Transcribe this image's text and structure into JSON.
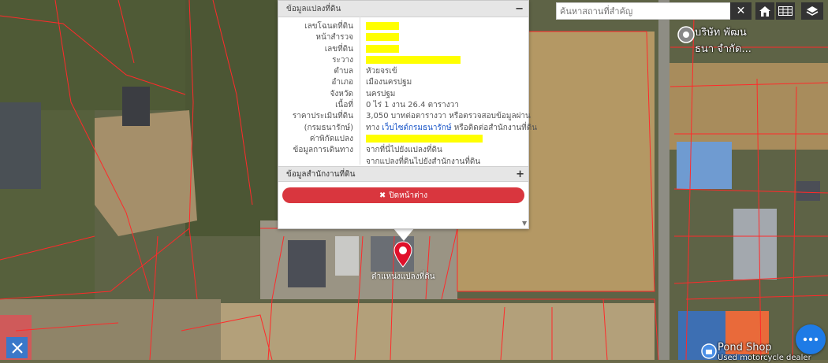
{
  "popup": {
    "section1_title": "ข้อมูลแปลงที่ดิน",
    "section1_toggle": "−",
    "rows": [
      {
        "label": "เลขโฉนดที่ดิน",
        "value": "",
        "redacted": true
      },
      {
        "label": "หน้าสำรวจ",
        "value": "",
        "redacted": true
      },
      {
        "label": "เลขที่ดิน",
        "value": "",
        "redacted": true
      },
      {
        "label": "ระวาง",
        "value": "",
        "redacted": true
      },
      {
        "label": "ตำบล",
        "value": "หัวยจรเข้",
        "redacted": false
      },
      {
        "label": "อำเภอ",
        "value": "เมืองนครปฐม",
        "redacted": false
      },
      {
        "label": "จังหวัด",
        "value": "นครปฐม",
        "redacted": false
      },
      {
        "label": "เนื้อที่",
        "value": "0 ไร่ 1 งาน 26.4 ตารางวา",
        "redacted": false
      }
    ],
    "price_label": "ราคาประเมินที่ดิน",
    "price_value": "3,050 บาทต่อตารางวา หรือตรวจสอบข้อมูลผ่าน",
    "price_label2": "(กรมธนารักษ์)",
    "price_value2_pre": "ทาง",
    "price_link": "เว็บไซต์กรมธนารักษ์",
    "price_value2_post": "หรือติดต่อสำนักงานที่ดิน",
    "coord_label": "ค่าพิกัดแปลง",
    "travel_label": "ข้อมูลการเดินทาง",
    "travel_link1": "จากที่นี่ไปยังแปลงที่ดิน",
    "travel_link2": "จากแปลงที่ดินไปยังสำนักงานที่ดิน",
    "section2_title": "ข้อมูลสำนักงานที่ดิน",
    "section2_toggle": "+",
    "close_label": "ปิดหน้าต่าง"
  },
  "search": {
    "placeholder": "ค้นหาสถานที่สำคัญ"
  },
  "map": {
    "pin_label": "ตำแหน่งแปลงที่ดิน",
    "place1": "บริษัท พัฒน",
    "place1b": "ธนา จำกัด...",
    "place2": "Pond Shop",
    "place2b": "Used motorcycle dealer"
  },
  "colors": {
    "accent": "#1e7be6",
    "close": "#d9363e",
    "redact": "#ffff00",
    "parcel": "#ff2a2a"
  }
}
